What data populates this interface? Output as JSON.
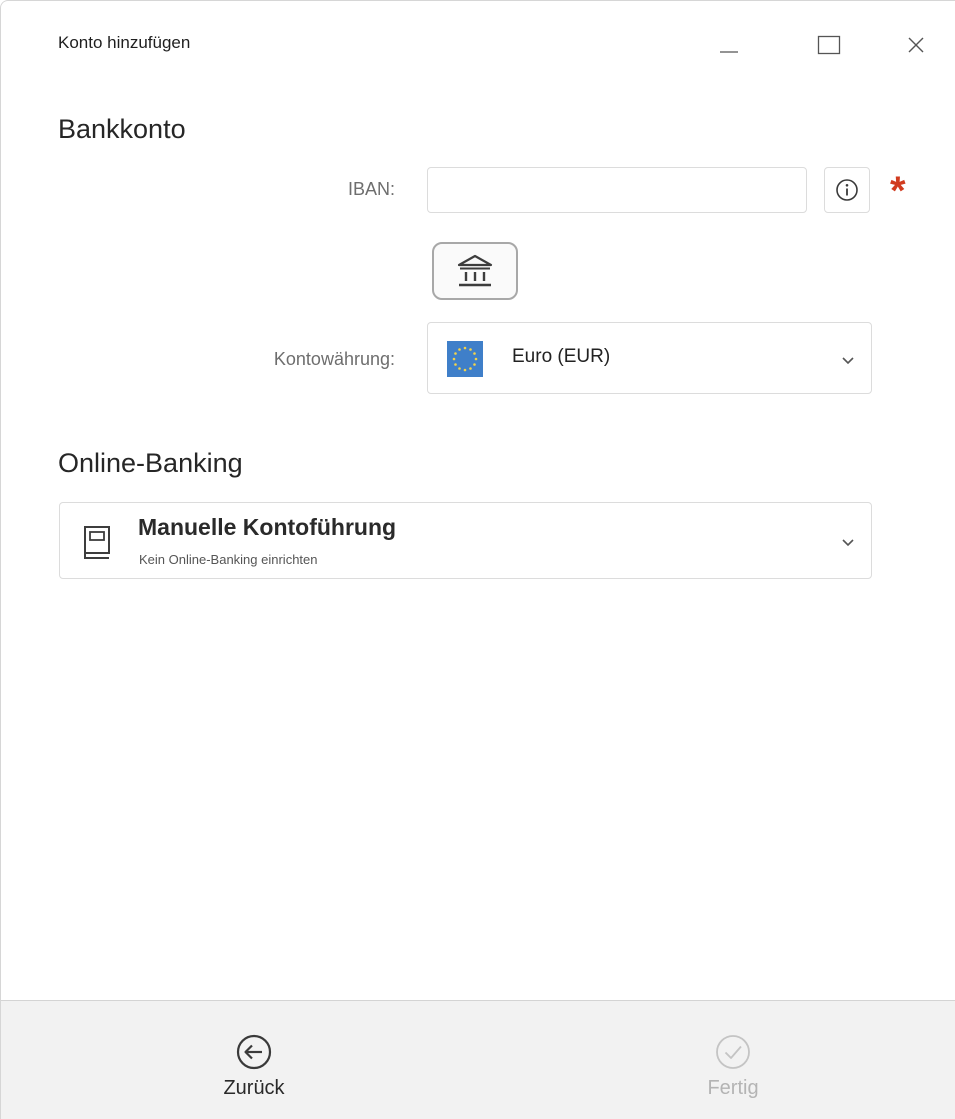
{
  "window": {
    "title": "Konto hinzufügen",
    "controls": [
      "minimize-icon",
      "maximize-icon",
      "close-icon"
    ]
  },
  "bank_account": {
    "heading": "Bankkonto",
    "iban_label": "IBAN:",
    "iban_value": "",
    "iban_placeholder": "",
    "info_icon": "info-icon",
    "required_marker": "*",
    "bank_button_icon": "bank-icon",
    "currency_label": "Kontowährung:",
    "currency_value": "Euro (EUR)",
    "currency_flag": "eu-flag-icon"
  },
  "online_banking": {
    "heading": "Online-Banking",
    "mode_title": "Manuelle Kontoführung",
    "mode_subtitle": "Kein Online-Banking einrichten",
    "mode_icon": "book-icon"
  },
  "footer": {
    "back_label": "Zurück",
    "back_icon": "arrow-left-circle-icon",
    "done_label": "Fertig",
    "done_icon": "check-circle-icon",
    "done_enabled": false
  },
  "colors": {
    "required": "#d13b1f",
    "flag_blue": "#3f7fc9",
    "flag_stars": "#f3d34a",
    "footer_bg": "#f2f2f2",
    "disabled_text": "#b4b4b4"
  }
}
